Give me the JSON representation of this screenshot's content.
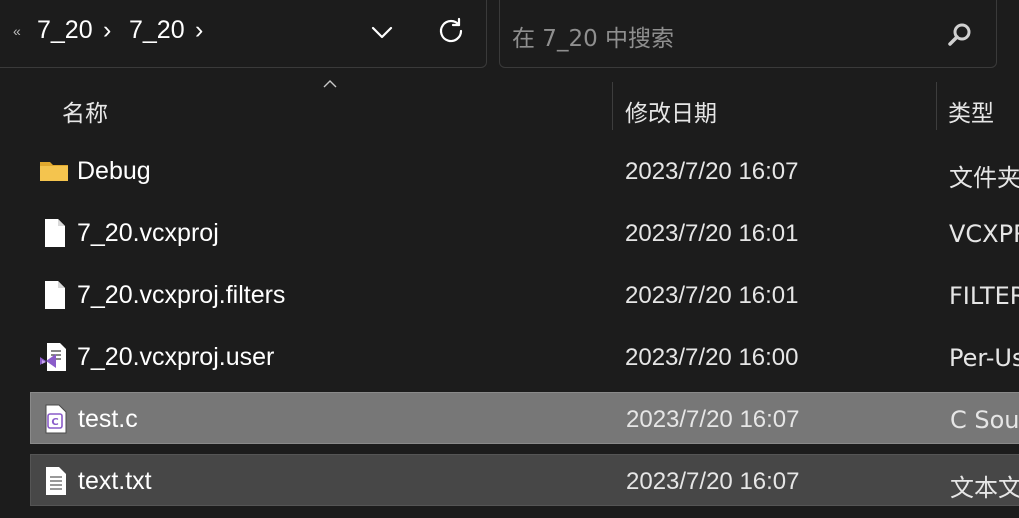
{
  "address": {
    "overflow": "«",
    "crumbs": [
      "7_20",
      "7_20"
    ],
    "separator": "›"
  },
  "search": {
    "placeholder": "在 7_20 中搜索"
  },
  "columns": {
    "name": "名称",
    "date": "修改日期",
    "type": "类型"
  },
  "files": [
    {
      "name": "Debug",
      "date": "2023/7/20 16:07",
      "type": "文件夹",
      "icon": "folder-icon"
    },
    {
      "name": "7_20.vcxproj",
      "date": "2023/7/20 16:01",
      "type": "VCXPROJ",
      "icon": "document-icon"
    },
    {
      "name": "7_20.vcxproj.filters",
      "date": "2023/7/20 16:01",
      "type": "FILTERS",
      "icon": "document-icon"
    },
    {
      "name": "7_20.vcxproj.user",
      "date": "2023/7/20 16:00",
      "type": "Per-User",
      "icon": "visual-studio-file-icon"
    },
    {
      "name": "test.c",
      "date": "2023/7/20 16:07",
      "type": "C Source",
      "icon": "c-source-file-icon"
    },
    {
      "name": "text.txt",
      "date": "2023/7/20 16:07",
      "type": "文本文档",
      "icon": "text-file-icon"
    }
  ],
  "colors": {
    "background": "#1c1c1c",
    "selected_row": "#777777",
    "hover_row": "#474747",
    "folder": "#f4c44e",
    "vs_purple": "#8a5cc9"
  }
}
